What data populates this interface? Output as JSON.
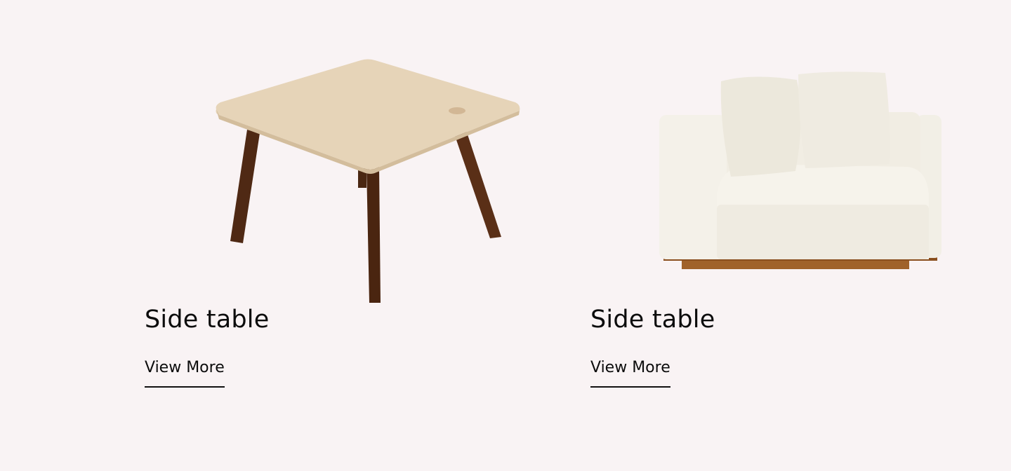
{
  "products": [
    {
      "title": "Side table",
      "link_label": "View More",
      "image_icon": "wooden-side-table-image"
    },
    {
      "title": "Side table",
      "link_label": "View More",
      "image_icon": "white-sofa-armchair-image"
    }
  ],
  "colors": {
    "background": "#f9f3f4",
    "text": "#0c0c0c"
  }
}
